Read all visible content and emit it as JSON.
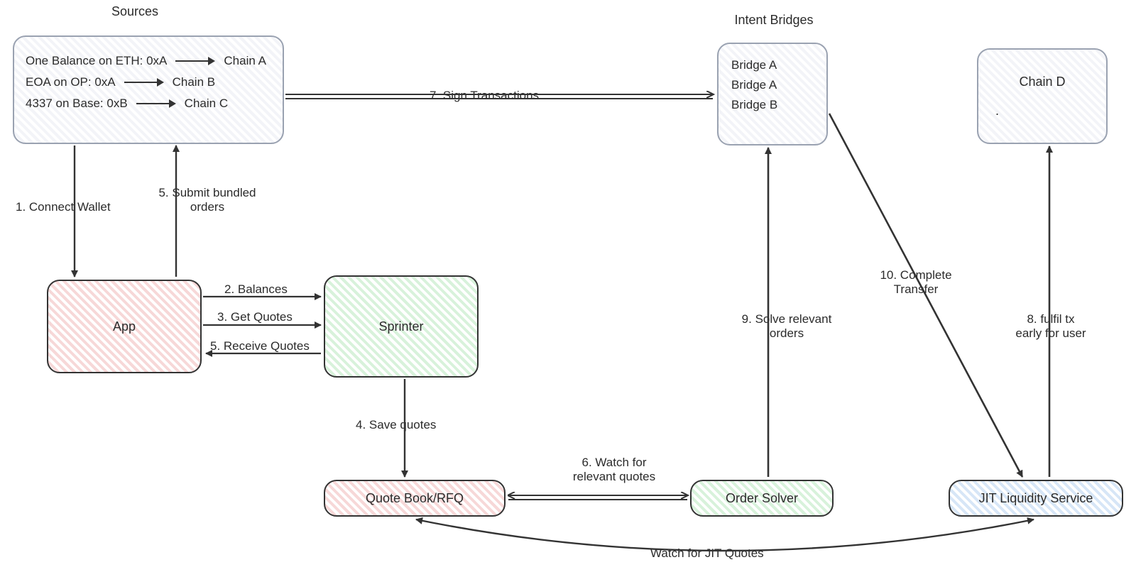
{
  "titles": {
    "sources": "Sources",
    "intentBridges": "Intent Bridges"
  },
  "sources": {
    "row1": {
      "left": "One Balance on ETH: 0xA",
      "right": "Chain A"
    },
    "row2": {
      "left": "EOA on OP: 0xA",
      "right": "Chain B"
    },
    "row3": {
      "left": "4337 on Base: 0xB",
      "right": "Chain C"
    }
  },
  "bridges": {
    "b1": "Bridge A",
    "b2": "Bridge A",
    "b3": "Bridge B"
  },
  "nodes": {
    "app": "App",
    "sprinter": "Sprinter",
    "quoteBook": "Quote Book/RFQ",
    "orderSolver": "Order Solver",
    "jit": "JIT Liquidity Service",
    "chainD": "Chain D",
    "chainDDot": "."
  },
  "edges": {
    "e1": "1. Connect Wallet",
    "e2": "2. Balances",
    "e3": "3. Get Quotes",
    "e4": "4. Save quotes",
    "e5open": "5. Submit bundled",
    "e5open2": "orders",
    "e5rec": "5. Receive Quotes",
    "e6a": "6. Watch for",
    "e6b": "relevant quotes",
    "e7": "7. Sign Transactions",
    "e8a": "8. fulfil tx",
    "e8b": "early for user",
    "e9a": "9. Solve relevant",
    "e9b": "orders",
    "e10a": "10. Complete",
    "e10b": "Transfer",
    "jitWatch": "Watch for JIT Quotes"
  }
}
